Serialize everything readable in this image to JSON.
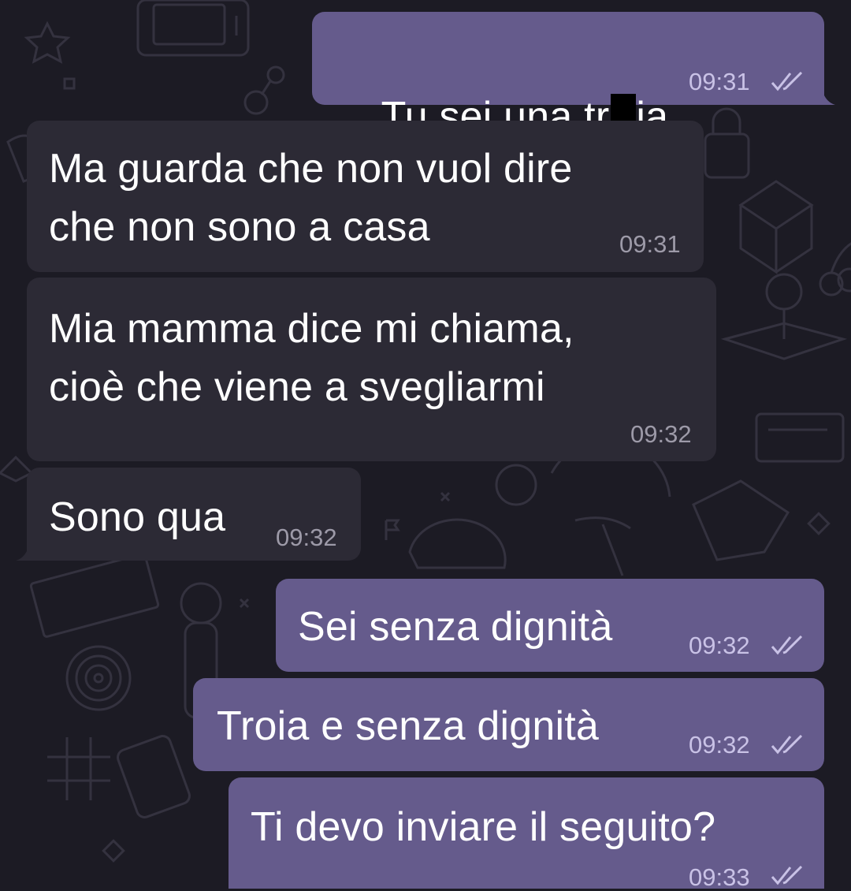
{
  "colors": {
    "background": "#1c1b24",
    "outgoing_bubble": "#655b8c",
    "incoming_bubble": "#2c2a35",
    "read_ticks": "#c9c2e6"
  },
  "messages": [
    {
      "direction": "outgoing",
      "text_a": "Tu sei una tr",
      "text_b": "ia",
      "time": "09:31",
      "status": "read-double-check-icon"
    },
    {
      "direction": "incoming",
      "line1": "Ma guarda che non vuol dire",
      "line2": "che non sono a casa",
      "time": "09:31"
    },
    {
      "direction": "incoming",
      "line1": "Mia mamma dice mi chiama,",
      "line2": "cioè che viene a svegliarmi",
      "time": "09:32"
    },
    {
      "direction": "incoming",
      "text": "Sono qua",
      "time": "09:32"
    },
    {
      "direction": "outgoing",
      "text": "Sei senza dignità",
      "time": "09:32",
      "status": "read-double-check-icon"
    },
    {
      "direction": "outgoing",
      "text": "Troia e senza dignità",
      "time": "09:32",
      "status": "read-double-check-icon"
    },
    {
      "direction": "outgoing",
      "text": "Ti devo inviare il seguito?",
      "time": "09:33",
      "status": "read-double-check-icon"
    }
  ],
  "wallpaper_icons": [
    "game-console-icon",
    "lock-icon",
    "rubiks-cube-icon",
    "joystick-icon",
    "cherry-icon",
    "retro-console-icon",
    "game-controller-icon",
    "mushroom-icon",
    "pickaxe-icon",
    "ghost-icon",
    "cap-icon",
    "target-icon",
    "tic-tac-toe-icon",
    "press-start-text-icon",
    "tree-icon",
    "motion-controller-icon",
    "heart-card-icon",
    "flag-icon"
  ]
}
